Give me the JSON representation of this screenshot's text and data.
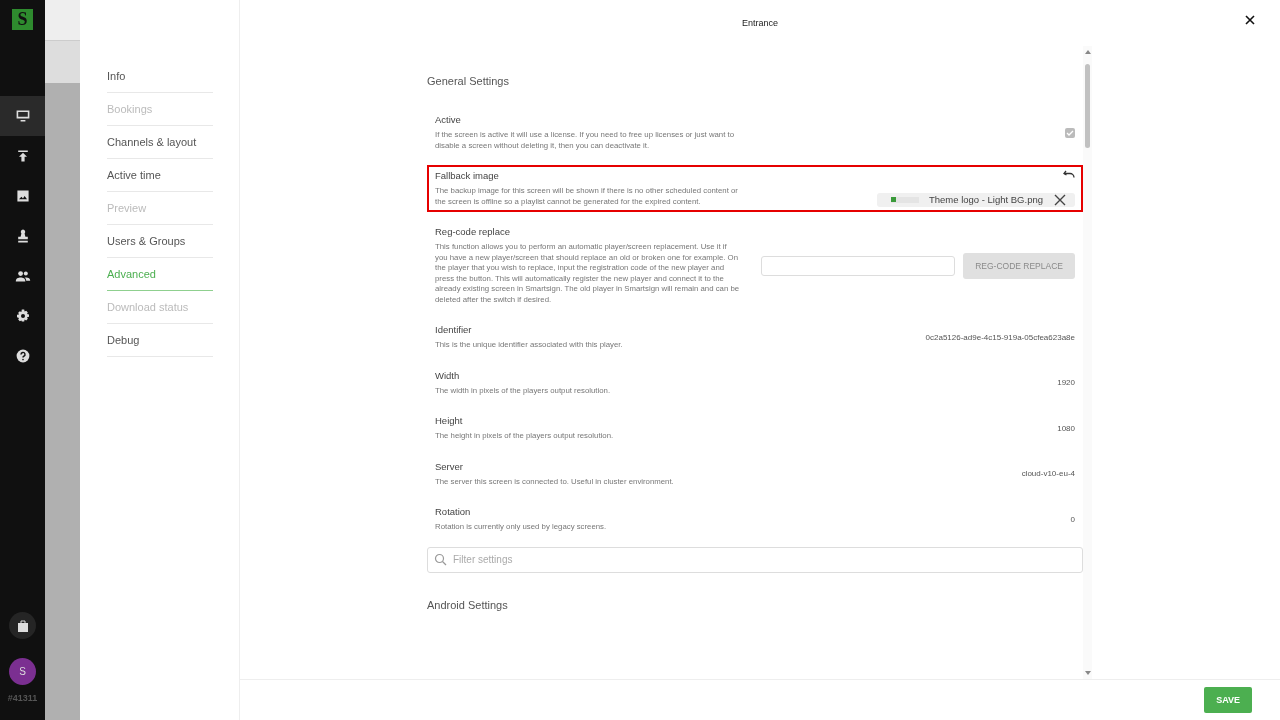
{
  "rail": {
    "logo": "S",
    "items": [
      {
        "selected": true
      },
      {
        "selected": false
      },
      {
        "selected": false
      },
      {
        "selected": false
      },
      {
        "selected": false
      },
      {
        "selected": false
      },
      {
        "selected": false
      }
    ],
    "avatar": "S",
    "account_id": "#41311"
  },
  "dialog": {
    "title": "Entrance",
    "nav": [
      {
        "label": "Info",
        "disabled": false,
        "selected": false
      },
      {
        "label": "Bookings",
        "disabled": true,
        "selected": false
      },
      {
        "label": "Channels & layout",
        "disabled": false,
        "selected": false
      },
      {
        "label": "Active time",
        "disabled": false,
        "selected": false
      },
      {
        "label": "Preview",
        "disabled": true,
        "selected": false
      },
      {
        "label": "Users & Groups",
        "disabled": false,
        "selected": false
      },
      {
        "label": "Advanced",
        "disabled": false,
        "selected": true
      },
      {
        "label": "Download status",
        "disabled": true,
        "selected": false
      },
      {
        "label": "Debug",
        "disabled": false,
        "selected": false
      }
    ],
    "section_title": "General Settings",
    "settings": [
      {
        "kind": "checkbox",
        "title": "Active",
        "description": "If the screen is active it will use a license. If you need to free up licenses or just want to disable a screen without deleting it, then you can deactivate it.",
        "checked": true,
        "highlighted": false
      },
      {
        "kind": "file",
        "title": "Fallback image",
        "description": "The backup image for this screen will be shown if there is no other scheduled content or the screen is offline so a playlist cannot be generated for the expired content.",
        "file_name": "Theme logo - Light BG.png",
        "highlighted": true
      },
      {
        "kind": "regcode",
        "title": "Reg-code replace",
        "description": "This function allows you to perform an automatic player/screen replacement. Use it if you have a new player/screen that should replace an old or broken one for example. On the player that you wish to replace, input the registration code of the new player and press the button. This will automatically register the new player and connect it to the already existing screen in Smartsign. The old player in Smartsign will remain and can be deleted after the switch if desired.",
        "button": "REG-CODE REPLACE",
        "highlighted": false
      },
      {
        "kind": "value",
        "title": "Identifier",
        "description": "This is the unique identifier associated with this player.",
        "value": "0c2a5126-ad9e-4c15-919a-05cfea623a8e",
        "highlighted": false
      },
      {
        "kind": "value",
        "title": "Width",
        "description": "The width in pixels of the players output resolution.",
        "value": "1920",
        "highlighted": false
      },
      {
        "kind": "value",
        "title": "Height",
        "description": "The height in pixels of the players output resolution.",
        "value": "1080",
        "highlighted": false
      },
      {
        "kind": "value",
        "title": "Server",
        "description": "The server this screen is connected to. Useful in cluster environment.",
        "value": "cloud-v10-eu-4",
        "highlighted": false
      },
      {
        "kind": "value",
        "title": "Rotation",
        "description": "Rotation is currently only used by legacy screens.",
        "value": "0",
        "highlighted": false
      }
    ],
    "filter": {
      "placeholder": "Filter settings"
    },
    "next_section_title": "Android Settings",
    "save_button": "SAVE"
  }
}
